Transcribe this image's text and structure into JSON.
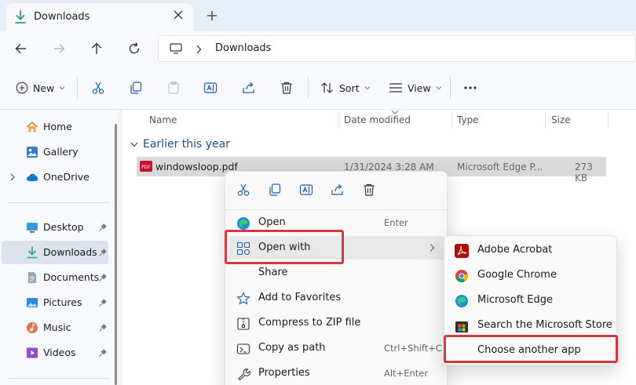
{
  "tab": {
    "title": "Downloads"
  },
  "address": {
    "crumb": "Downloads"
  },
  "toolbar": {
    "new_label": "New",
    "sort_label": "Sort",
    "view_label": "View"
  },
  "sidebar": {
    "items": [
      {
        "label": "Home",
        "icon": "home-icon"
      },
      {
        "label": "Gallery",
        "icon": "gallery-icon"
      },
      {
        "label": "OneDrive",
        "icon": "onedrive-icon"
      },
      {
        "label": "Desktop",
        "icon": "desktop-icon"
      },
      {
        "label": "Downloads",
        "icon": "download-icon"
      },
      {
        "label": "Documents",
        "icon": "documents-icon"
      },
      {
        "label": "Pictures",
        "icon": "pictures-icon"
      },
      {
        "label": "Music",
        "icon": "music-icon"
      },
      {
        "label": "Videos",
        "icon": "videos-icon"
      }
    ]
  },
  "columns": {
    "name": "Name",
    "date": "Date modified",
    "type": "Type",
    "size": "Size"
  },
  "group": {
    "label": "Earlier this year"
  },
  "file": {
    "name": "windowsloop.pdf",
    "date": "1/31/2024 3:28 AM",
    "type": "Microsoft Edge P...",
    "size": "273 KB"
  },
  "context_menu": {
    "items": [
      {
        "label": "Open",
        "shortcut": "Enter"
      },
      {
        "label": "Open with",
        "shortcut": ""
      },
      {
        "label": "Share",
        "shortcut": ""
      },
      {
        "label": "Add to Favorites",
        "shortcut": ""
      },
      {
        "label": "Compress to ZIP file",
        "shortcut": ""
      },
      {
        "label": "Copy as path",
        "shortcut": "Ctrl+Shift+C"
      },
      {
        "label": "Properties",
        "shortcut": "Alt+Enter"
      }
    ]
  },
  "open_with_submenu": {
    "items": [
      {
        "label": "Adobe Acrobat"
      },
      {
        "label": "Google Chrome"
      },
      {
        "label": "Microsoft Edge"
      },
      {
        "label": "Search the Microsoft Store"
      },
      {
        "label": "Choose another app"
      }
    ]
  },
  "colors": {
    "accent": "#0067c0",
    "annotation": "#d9363e",
    "pdf_red": "#c8102e"
  }
}
